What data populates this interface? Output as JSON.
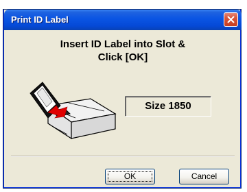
{
  "window": {
    "title": "Print ID Label",
    "close_icon": "close-icon"
  },
  "message": {
    "line1": "Insert ID Label into Slot &",
    "line2": "Click [OK]"
  },
  "illustration": {
    "icon": "printer-insert-label-icon"
  },
  "size_display": {
    "text": "Size 1850"
  },
  "buttons": {
    "ok_label": "OK",
    "cancel_label": "Cancel"
  },
  "colors": {
    "titlebar": "#0a54e3",
    "dialog_bg": "#ece9d8",
    "close_button": "#d9573c",
    "arrow": "#e00000"
  }
}
